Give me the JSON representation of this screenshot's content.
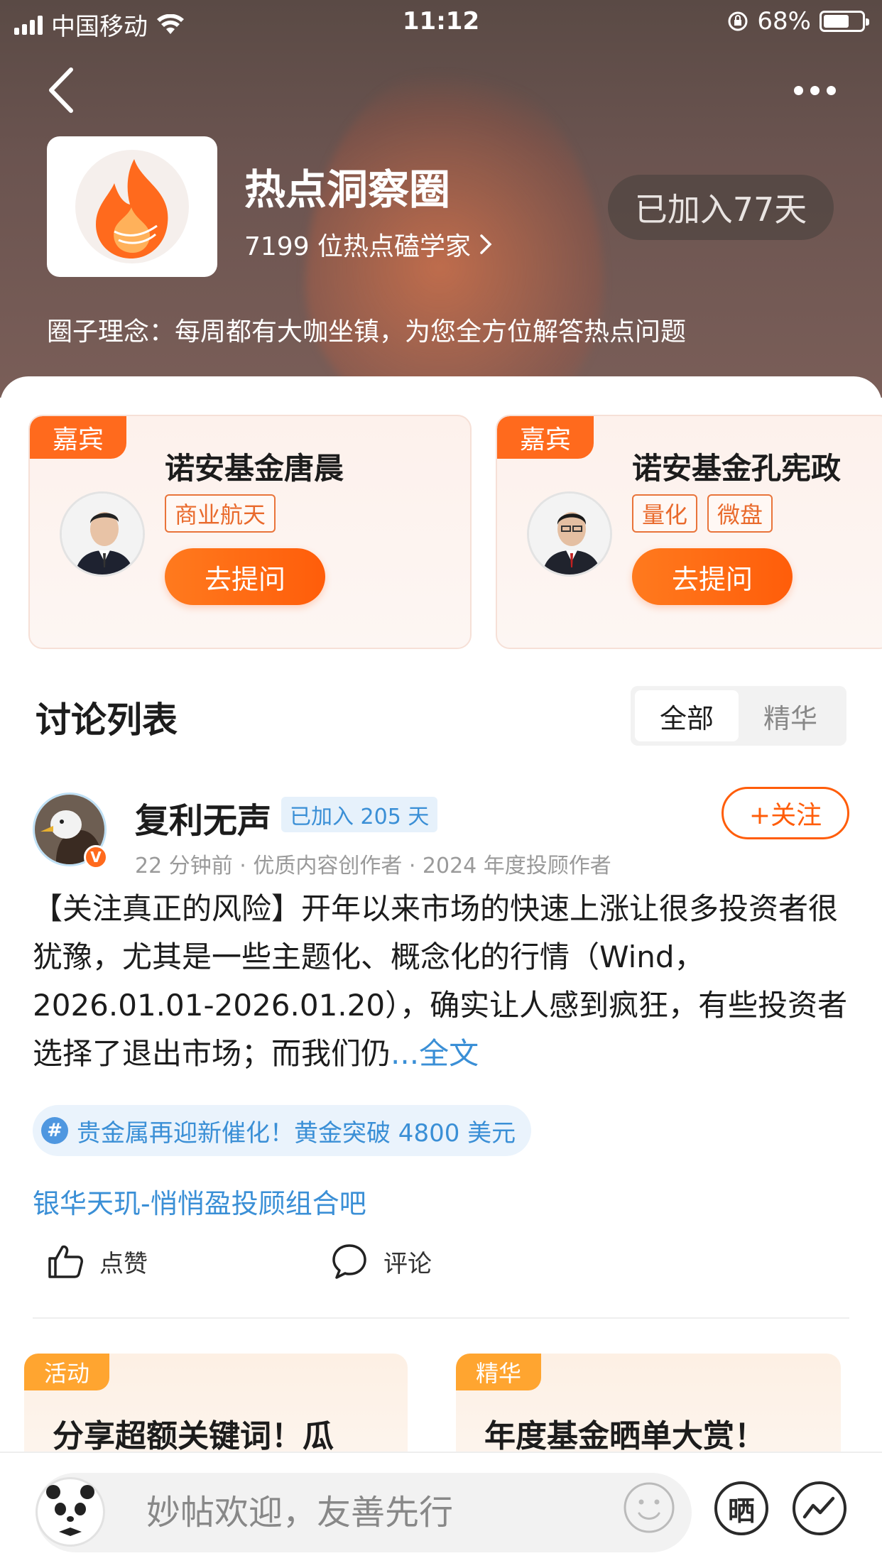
{
  "status_bar": {
    "carrier": "中国移动",
    "time": "11:12",
    "battery": "68%"
  },
  "header": {
    "circle_name": "热点洞察圈",
    "members": "7199 位热点磕学家",
    "joined_days": "已加入77天",
    "motto": "圈子理念：每周都有大咖坐镇，为您全方位解答热点问题"
  },
  "guests": [
    {
      "tag": "嘉宾",
      "name": "诺安基金唐晨",
      "topics": [
        "商业航天"
      ],
      "ask_label": "去提问"
    },
    {
      "tag": "嘉宾",
      "name": "诺安基金孔宪政",
      "topics": [
        "量化",
        "微盘"
      ],
      "ask_label": "去提问"
    }
  ],
  "discussion": {
    "title": "讨论列表",
    "tabs": [
      "全部",
      "精华"
    ],
    "active_tab": "全部"
  },
  "post": {
    "author": "复利无声",
    "joined": "已加入 205 天",
    "follow_label": "+关注",
    "meta": "22 分钟前 · 优质内容创作者 · 2024 年度投顾作者",
    "body": "【关注真正的风险】开年以来市场的快速上涨让很多投资者很犹豫，尤其是一些主题化、概念化的行情（Wind，2026.01.01-2026.01.20），确实让人感到疯狂，有些投资者选择了退出市场；而我们仍",
    "more_label": "...全文",
    "topic": "贵金属再迎新催化！黄金突破 4800 美元",
    "link": "银华天玑-悄悄盈投顾组合吧",
    "like_label": "点赞",
    "comment_label": "评论"
  },
  "promos": [
    {
      "tag": "活动",
      "title": "分享超额关键词！瓜"
    },
    {
      "tag": "精华",
      "title": "年度基金晒单大赏！"
    }
  ],
  "bottom_bar": {
    "placeholder": "妙帖欢迎，友善先行",
    "sun_label": "晒"
  },
  "colors": {
    "accent": "#ff5d0a",
    "link": "#3a8fd6",
    "header_bg": "#5a4a45"
  }
}
